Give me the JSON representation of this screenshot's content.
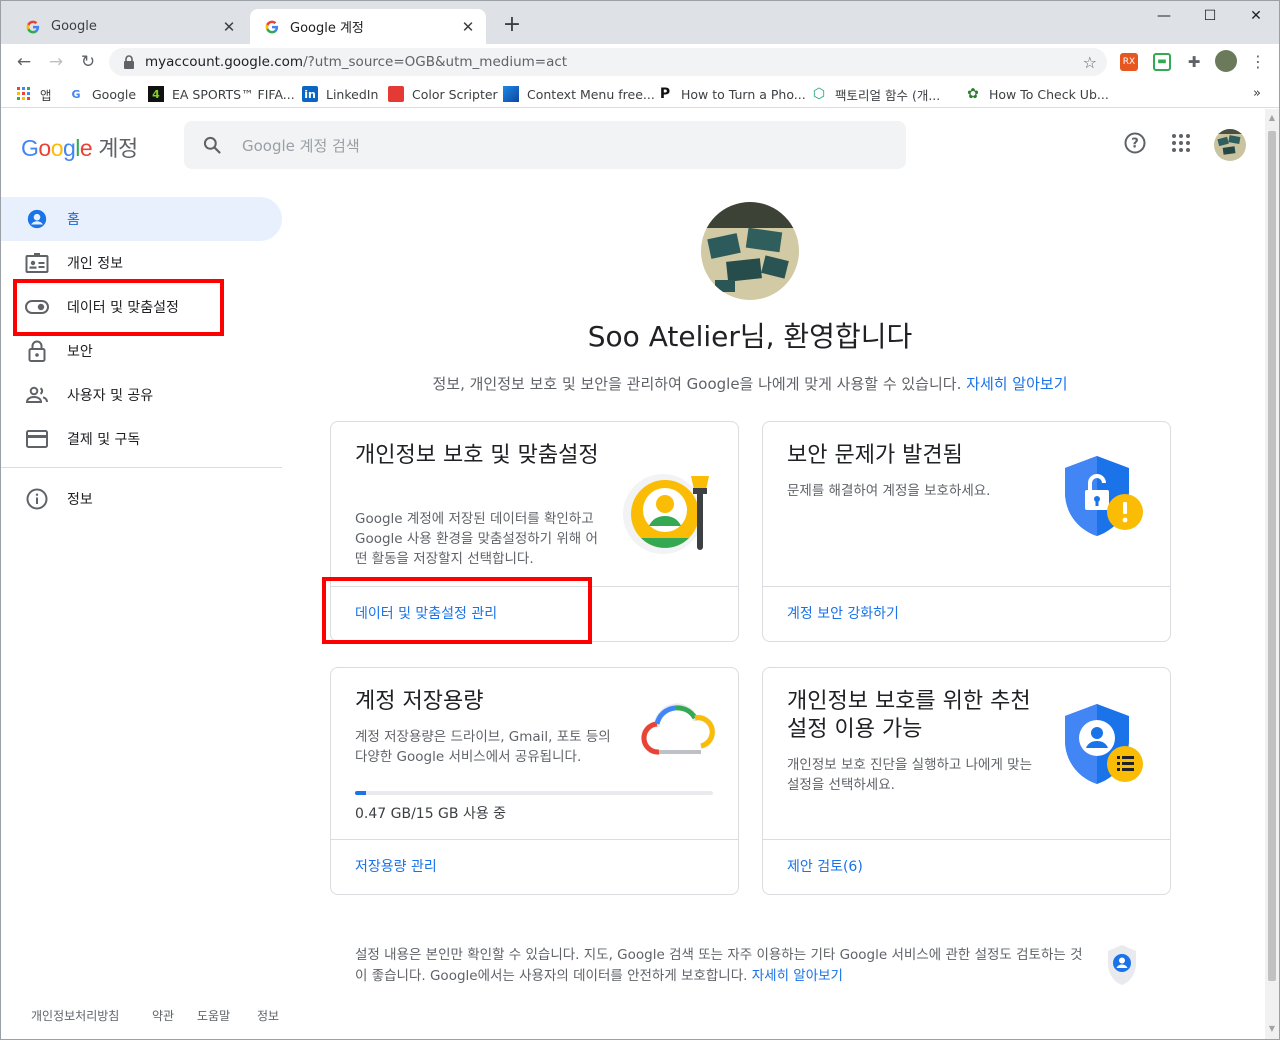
{
  "browser": {
    "tabs": [
      {
        "title": "Google",
        "active": false
      },
      {
        "title": "Google 계정",
        "active": true
      }
    ],
    "new_tab": "+",
    "url_host": "myaccount.google.com",
    "url_path": "/?utm_source=OGB&utm_medium=act",
    "bookmarks": [
      {
        "label": "앱",
        "icon": "apps-grid-icon"
      },
      {
        "label": "Google",
        "icon": "google-g-icon"
      },
      {
        "label": "EA SPORTS™ FIFA...",
        "icon": "ea-sports-icon"
      },
      {
        "label": "LinkedIn",
        "icon": "linkedin-icon"
      },
      {
        "label": "Color Scripter",
        "icon": "color-scripter-icon"
      },
      {
        "label": "Context Menu free...",
        "icon": "context-menu-icon"
      },
      {
        "label": "How to Turn a Pho...",
        "icon": "p-letter-icon"
      },
      {
        "label": "팩토리얼 함수 (개...",
        "icon": "shield-hex-icon"
      },
      {
        "label": "How To Check Ub...",
        "icon": "gear-flower-icon"
      }
    ],
    "bookmarks_more": "»"
  },
  "header": {
    "logo_google": "Google",
    "logo_suffix": "계정",
    "search_placeholder": "Google 계정 검색"
  },
  "sidebar": {
    "items": [
      {
        "label": "홈",
        "icon": "account-circle-icon",
        "active": true
      },
      {
        "label": "개인 정보",
        "icon": "id-card-icon",
        "active": false
      },
      {
        "label": "데이터 및 맞춤설정",
        "icon": "toggle-icon",
        "active": false
      },
      {
        "label": "보안",
        "icon": "lock-icon",
        "active": false
      },
      {
        "label": "사용자 및 공유",
        "icon": "people-icon",
        "active": false
      },
      {
        "label": "결제 및 구독",
        "icon": "credit-card-icon",
        "active": false
      }
    ],
    "info_label": "정보",
    "footer": [
      "개인정보처리방침",
      "약관",
      "도움말",
      "정보"
    ]
  },
  "main": {
    "welcome": "Soo Atelier님, 환영합니다",
    "subtitle": "정보, 개인정보 보호 및 보안을 관리하여 Google을 나에게 맞게 사용할 수 있습니다.",
    "subtitle_link": "자세히 알아보기",
    "cards": [
      {
        "title": "개인정보 보호 및 맞춤설정",
        "desc": "Google 계정에 저장된 데이터를 확인하고 Google 사용 환경을 맞춤설정하기 위해 어떤 활동을 저장할지 선택합니다.",
        "link": "데이터 및 맞춤설정 관리"
      },
      {
        "title": "보안 문제가 발견됨",
        "desc": "문제를 해결하여 계정을 보호하세요.",
        "link": "계정 보안 강화하기"
      },
      {
        "title": "계정 저장용량",
        "desc": "계정 저장용량은 드라이브, Gmail, 포토 등의 다양한 Google 서비스에서 공유됩니다.",
        "usage": "0.47 GB/15 GB 사용 중",
        "usage_fraction": 0.031,
        "link": "저장용량 관리"
      },
      {
        "title": "개인정보 보호를 위한 추천 설정 이용 가능",
        "desc": "개인정보 보호 진단을 실행하고 나에게 맞는 설정을 선택하세요.",
        "link": "제안 검토(6)"
      }
    ],
    "privacy_note": "설정 내용은 본인만 확인할 수 있습니다. 지도, Google 검색 또는 자주 이용하는 기타 Google 서비스에 관한 설정도 검토하는 것이 좋습니다. Google에서는 사용자의 데이터를 안전하게 보호합니다.",
    "privacy_note_link": "자세히 알아보기"
  },
  "colors": {
    "accent": "#1a73e8",
    "active_nav_bg": "#e8f0fe",
    "annotation_red": "#ff0000"
  }
}
